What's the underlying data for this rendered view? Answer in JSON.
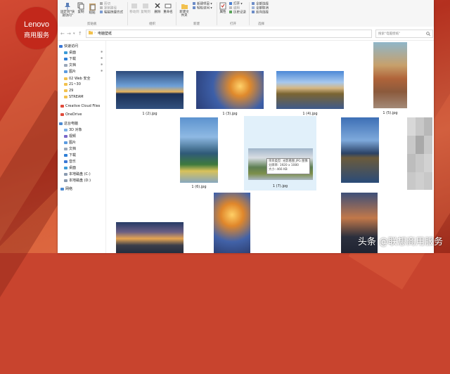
{
  "brand": {
    "name": "Lenovo",
    "sub": "商用服务"
  },
  "watermark": "头条 @联想商用服务",
  "ribbon": {
    "clipboard": {
      "pin": "固定到\"快速访问\"",
      "copy": "复制",
      "paste": "粘贴",
      "cut": "剪切",
      "copy_path": "复制路径",
      "paste_shortcut": "粘贴快捷方式",
      "group": "剪贴板"
    },
    "organize": {
      "move_to": "移动到",
      "copy_to": "复制到",
      "delete": "删除",
      "rename": "重命名",
      "group": "组织"
    },
    "new": {
      "new_folder": "新建文件夹",
      "new_item": "新建项目",
      "easy_access": "轻松访问",
      "group": "新建"
    },
    "open": {
      "properties": "属性",
      "open": "打开",
      "edit": "编辑",
      "history": "历史记录",
      "group": "打开"
    },
    "select": {
      "select_all": "全部选择",
      "select_none": "全部取消",
      "invert": "反向选择",
      "group": "选择"
    }
  },
  "address": {
    "path": "电脑壁纸",
    "search_placeholder": "搜索\"电脑壁纸\""
  },
  "sidebar": {
    "items": [
      {
        "label": "快速访问",
        "icon": "star-icon",
        "pinned": false
      },
      {
        "label": "桌面",
        "icon": "desktop-icon",
        "pinned": true
      },
      {
        "label": "下载",
        "icon": "download-icon",
        "pinned": true
      },
      {
        "label": "文档",
        "icon": "document-icon",
        "pinned": true
      },
      {
        "label": "图片",
        "icon": "picture-icon",
        "pinned": true
      },
      {
        "label": "02 Web 安全",
        "icon": "folder-icon",
        "pinned": false
      },
      {
        "label": "21~30",
        "icon": "folder-icon",
        "pinned": false
      },
      {
        "label": "29",
        "icon": "folder-icon",
        "pinned": false
      },
      {
        "label": "STREAM",
        "icon": "folder-icon",
        "pinned": false
      },
      {
        "label": "Creative Cloud Files",
        "icon": "cloud-icon",
        "pinned": false
      },
      {
        "label": "OneDrive",
        "icon": "cloud-icon",
        "pinned": false
      },
      {
        "label": "这台电脑",
        "icon": "computer-icon",
        "pinned": false
      },
      {
        "label": "3D 对象",
        "icon": "cube-icon",
        "pinned": false
      },
      {
        "label": "视频",
        "icon": "video-icon",
        "pinned": false
      },
      {
        "label": "图片",
        "icon": "picture-icon",
        "pinned": false
      },
      {
        "label": "文档",
        "icon": "document-icon",
        "pinned": false
      },
      {
        "label": "下载",
        "icon": "download-icon",
        "pinned": false
      },
      {
        "label": "音乐",
        "icon": "music-icon",
        "pinned": false
      },
      {
        "label": "桌面",
        "icon": "desktop-icon",
        "pinned": false
      },
      {
        "label": "本地磁盘 (C:)",
        "icon": "drive-icon",
        "pinned": false
      },
      {
        "label": "本地磁盘 (D:)",
        "icon": "drive-icon",
        "pinned": false
      },
      {
        "label": "网络",
        "icon": "network-icon",
        "pinned": false
      }
    ]
  },
  "files": [
    {
      "name": "1 (2).jpg",
      "selected": false
    },
    {
      "name": "1 (3).jpg",
      "selected": false
    },
    {
      "name": "1 (4).jpg",
      "selected": false
    },
    {
      "name": "1 (5).jpg",
      "selected": false
    },
    {
      "name": "1 (6).jpg",
      "selected": false
    },
    {
      "name": "1 (7).jpg",
      "selected": true
    },
    {
      "name": "",
      "selected": false
    },
    {
      "name": "",
      "selected": false
    },
    {
      "name": "",
      "selected": false
    },
    {
      "name": "",
      "selected": false
    },
    {
      "name": "",
      "selected": false
    }
  ],
  "tooltip": {
    "type": "项目类型: 光影看图 JPG 图像",
    "dims": "分辨率: 1920 x 1080",
    "size": "大小: 466 KB"
  },
  "colors": {
    "accent": "#c2281b",
    "selection": "#cde6f7",
    "folder": "#f2c14e"
  }
}
